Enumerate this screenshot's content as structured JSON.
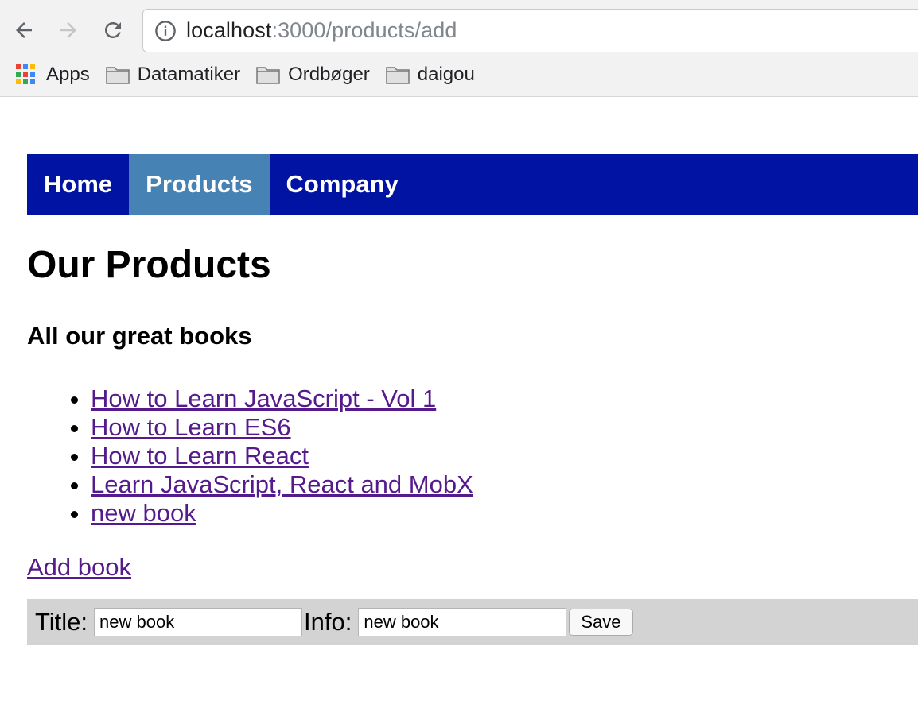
{
  "browser": {
    "url_host": "localhost",
    "url_rest": ":3000/products/add",
    "bookmarks": [
      {
        "label": "Apps",
        "icon": "apps-grid-icon"
      },
      {
        "label": "Datamatiker",
        "icon": "folder-icon"
      },
      {
        "label": "Ordbøger",
        "icon": "folder-icon"
      },
      {
        "label": "daigou",
        "icon": "folder-icon"
      }
    ]
  },
  "menu": {
    "items": [
      {
        "label": "Home"
      },
      {
        "label": "Products"
      },
      {
        "label": "Company"
      }
    ],
    "active": "Products",
    "bg_color": "#0013a3",
    "active_color": "#4682b4"
  },
  "main": {
    "title": "Our Products",
    "subtitle": "All our great books",
    "books": [
      "How to Learn JavaScript - Vol 1",
      "How to Learn ES6",
      "How to Learn React",
      "Learn JavaScript, React and MobX",
      "new book"
    ],
    "add_link": "Add book"
  },
  "form": {
    "title_label": "Title:",
    "title_value": "new book",
    "info_label": "Info:",
    "info_value": "new book",
    "save_label": "Save"
  }
}
